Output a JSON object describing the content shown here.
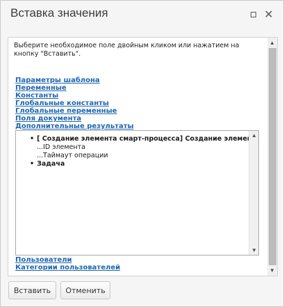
{
  "dialog": {
    "title": "Вставка значения",
    "maximize_icon": "maximize-icon",
    "close_icon": "close-icon",
    "close_glyph": "✕"
  },
  "instruction": "Выберите необходимое поле двойным кликом или нажатием на кнопку \"Вставить\".",
  "links": [
    "Параметры шаблона",
    "Переменные",
    "Константы",
    "Глобальные константы",
    "Глобальные переменные",
    "Поля документа",
    "Дополнительные результаты"
  ],
  "tree": {
    "items": [
      {
        "bullet": "•",
        "label": "[ Создание элемента смарт-процесса] Создание элемента смарт-процесса"
      },
      {
        "label": "...ID элемента"
      },
      {
        "label": "...Таймаут операции"
      },
      {
        "bullet": "•",
        "label": "Задача"
      }
    ]
  },
  "links_bottom": [
    "Пользователи",
    "Категории пользователей"
  ],
  "buttons": {
    "insert": "Вставить",
    "cancel": "Отменить"
  },
  "colors": {
    "link": "#2067b0",
    "background": "#f5f5f5"
  }
}
